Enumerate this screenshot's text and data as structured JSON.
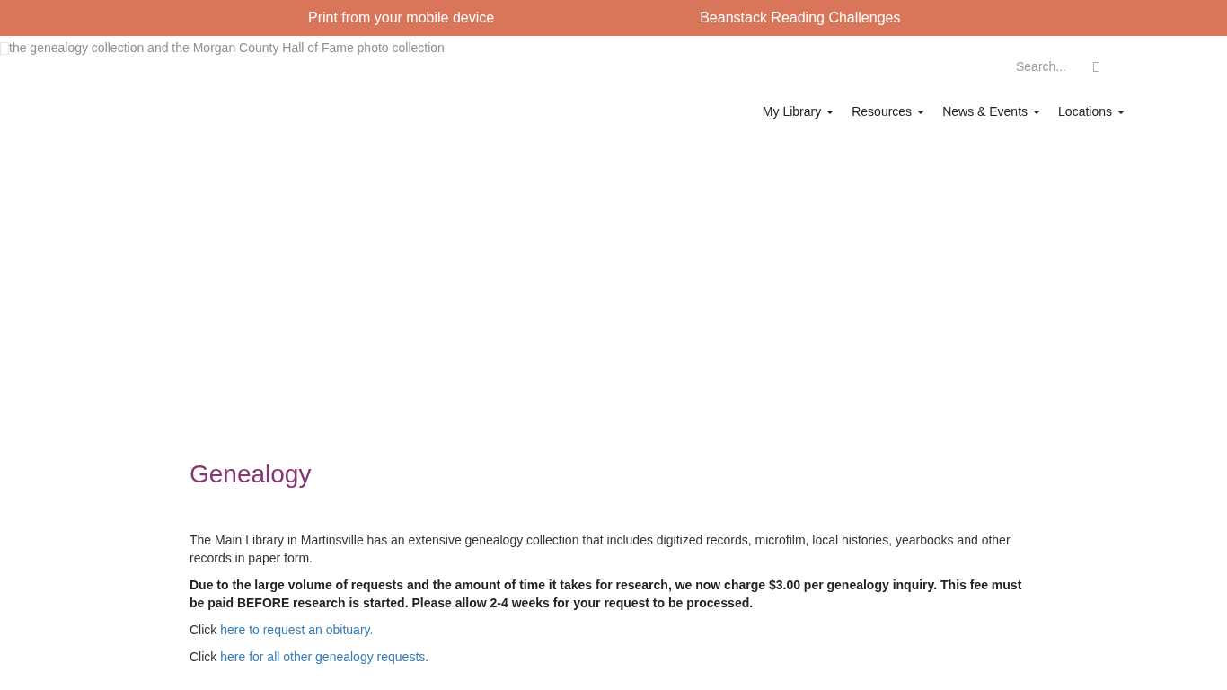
{
  "top_bar": {
    "links": [
      {
        "label": "Print from your mobile device"
      },
      {
        "label": "Beanstack Reading Challenges"
      }
    ]
  },
  "banner_image": {
    "alt": "the genealogy collection and the Morgan County Hall of Fame photo collection"
  },
  "search": {
    "placeholder": "Search..."
  },
  "nav": {
    "items": [
      {
        "label": "My Library"
      },
      {
        "label": "Resources"
      },
      {
        "label": "News & Events"
      },
      {
        "label": "Locations"
      }
    ]
  },
  "content": {
    "title": "Genealogy",
    "paragraphs": [
      {
        "kind": "text",
        "text": "The Main Library in Martinsville has an extensive genealogy collection that includes digitized records, microfilm, local histories, yearbooks and other records in paper form."
      },
      {
        "kind": "bold",
        "text": "Due to the large volume of requests and the amount of time it takes for research, we now charge $3.00 per genealogy inquiry. This fee must be paid BEFORE research is started. Please allow 2-4 weeks for your request to be processed."
      },
      {
        "kind": "link",
        "text": "Click ",
        "link": "here to request an obituary."
      },
      {
        "kind": "link",
        "text": "Click ",
        "link": "here for all other genealogy requests."
      }
    ]
  }
}
